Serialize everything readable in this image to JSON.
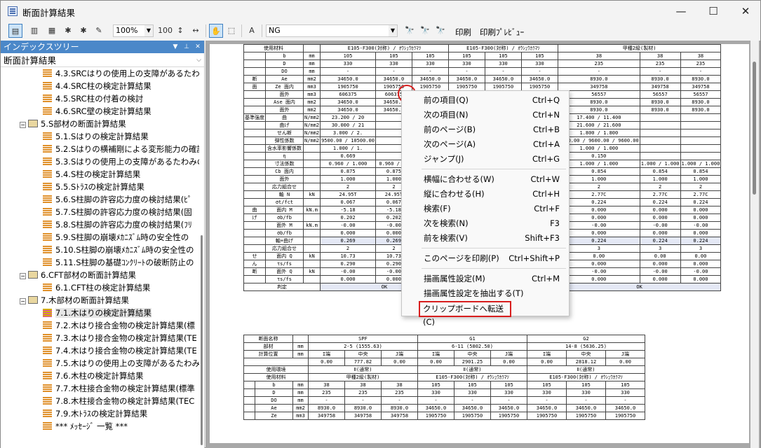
{
  "window": {
    "title": "断面計算結果",
    "minimize": "—",
    "maximize": "☐",
    "close": "✕"
  },
  "toolbar": {
    "zoom": "100%",
    "find_value": "NG",
    "print_label": "印刷",
    "preview_label": "印刷ﾌﾟﾚﾋﾞｭｰ"
  },
  "left_pane": {
    "title": "インデックスツリー",
    "selector": "断面計算結果",
    "items": [
      {
        "label": "4.3.SRCはりの使用上の支障があるたわみ",
        "kind": "leaf"
      },
      {
        "label": "4.4.SRC柱の検定計算結果",
        "kind": "leaf"
      },
      {
        "label": "4.5.SRC柱の付着の検討",
        "kind": "leaf"
      },
      {
        "label": "4.6.SRC壁の検定計算結果",
        "kind": "leaf"
      },
      {
        "label": "5.S部材の断面計算結果",
        "kind": "folder"
      },
      {
        "label": "5.1.Sはりの検定計算結果",
        "kind": "leaf"
      },
      {
        "label": "5.2.Sはりの横補剛による変形能力の確認",
        "kind": "leaf"
      },
      {
        "label": "5.3.Sはりの使用上の支障があるたわみの",
        "kind": "leaf"
      },
      {
        "label": "5.4.S柱の検定計算結果",
        "kind": "leaf"
      },
      {
        "label": "5.5.Sﾄﾗｽの検定計算結果",
        "kind": "leaf"
      },
      {
        "label": "5.6.S柱脚の許容応力度の検討結果(ﾋﾟ",
        "kind": "leaf"
      },
      {
        "label": "5.7.S柱脚の許容応力度の検討結果(固",
        "kind": "leaf"
      },
      {
        "label": "5.8.S柱脚の許容応力度の検討結果(ﾌﾘ",
        "kind": "leaf"
      },
      {
        "label": "5.9.S柱脚の崩壊ﾒｶﾆｽﾞﾑ時の安全性の",
        "kind": "leaf"
      },
      {
        "label": "5.10.S柱脚の崩壊ﾒｶﾆｽﾞﾑ時の安全性の",
        "kind": "leaf"
      },
      {
        "label": "5.11.S柱脚の基礎ｺﾝｸﾘｰﾄの破断防止の",
        "kind": "leaf"
      },
      {
        "label": "6.CFT部材の断面計算結果",
        "kind": "folder"
      },
      {
        "label": "6.1.CFT柱の検定計算結果",
        "kind": "leaf"
      },
      {
        "label": "7.木部材の断面計算結果",
        "kind": "folder"
      },
      {
        "label": "7.1.木はりの検定計算結果",
        "kind": "selected"
      },
      {
        "label": "7.2.木はり接合金物の検定計算結果(標",
        "kind": "leaf"
      },
      {
        "label": "7.3.木はり接合金物の検定計算結果(TE",
        "kind": "leaf"
      },
      {
        "label": "7.4.木はり接合金物の検定計算結果(TE",
        "kind": "leaf"
      },
      {
        "label": "7.5.木はりの使用上の支障があるたわみの",
        "kind": "leaf"
      },
      {
        "label": "7.6.木柱の検定計算結果",
        "kind": "leaf"
      },
      {
        "label": "7.7.木柱接合金物の検定計算結果(標準",
        "kind": "leaf"
      },
      {
        "label": "7.8.木柱接合金物の検定計算結果(TEC",
        "kind": "leaf"
      },
      {
        "label": "7.9.木ﾄﾗｽの検定計算結果",
        "kind": "leaf"
      },
      {
        "label": "*** ﾒｯｾｰｼﾞ 一覧 ***",
        "kind": "leaf"
      }
    ]
  },
  "table1": {
    "header": [
      "使用材料",
      "",
      "E105-F300(対称) / ｵｳｼｭｳｶﾗﾏﾂ",
      "E105-F300(対称) / ｵｳｼｭｳｶﾗﾏﾂ",
      "甲種2級(製材)"
    ],
    "rows": [
      [
        "",
        "b",
        "mm",
        "105",
        "105",
        "105",
        "105",
        "105",
        "105",
        "38",
        "38",
        "38"
      ],
      [
        "",
        "D",
        "mm",
        "330",
        "330",
        "330",
        "330",
        "330",
        "330",
        "235",
        "235",
        "235"
      ],
      [
        "",
        "DO",
        "mm",
        "-",
        "-",
        "-",
        "-",
        "-",
        "-",
        "-",
        "-",
        "-"
      ],
      [
        "断",
        "Ae",
        "mm2",
        "34650.0",
        "34650.0",
        "34650.0",
        "34650.0",
        "34650.0",
        "34650.0",
        "8930.0",
        "8930.0",
        "8930.0"
      ],
      [
        "面",
        "Ze 面内",
        "mm3",
        "1905750",
        "1905750",
        "1905750",
        "1905750",
        "1905750",
        "1905750",
        "349758",
        "349758",
        "349758"
      ],
      [
        "",
        "面外",
        "mm3",
        "606375",
        "606375",
        "606375",
        "606375",
        "606375",
        "606375",
        "56557",
        "56557",
        "56557"
      ],
      [
        "",
        "Ase 面内",
        "mm2",
        "34650.0",
        "34650.0",
        "34650.0",
        "34650.0",
        "34650.0",
        "34650.0",
        "8930.0",
        "8930.0",
        "8930.0"
      ],
      [
        "",
        "面外",
        "mm2",
        "34650.0",
        "34650.0",
        "34650.0",
        "34650.0",
        "34650.0",
        "34650.0",
        "8930.0",
        "8930.0",
        "8930.0"
      ],
      [
        "基準強度",
        "曲",
        "N/mm2",
        "23.200 / 20",
        "",
        "",
        "",
        "",
        "",
        "17.400 / 11.400",
        "",
        ""
      ],
      [
        "",
        "曲げ",
        "N/mm2",
        "30.000 / 21",
        "",
        "",
        "",
        "",
        "",
        "21.600 / 21.600",
        "",
        ""
      ],
      [
        "",
        "せん断",
        "N/mm2",
        "3.000 / 2.",
        "",
        "",
        "",
        "",
        "",
        "1.800 / 1.800",
        "",
        ""
      ],
      [
        "",
        "弾性係数",
        "N/mm2",
        "9500.00 / 10500.00",
        "",
        "",
        "",
        "",
        "",
        "9600.00 / 9600.00 / 9600.00",
        "",
        ""
      ],
      [
        "",
        "含水率影響係数",
        "",
        "1.000 / 1.",
        "",
        "",
        "",
        "",
        "",
        "1.000 / 1.000",
        "",
        ""
      ],
      [
        "",
        "η",
        "",
        "0.669",
        "",
        "",
        "",
        "",
        "",
        "0.150",
        "",
        ""
      ],
      [
        "",
        "寸法係数",
        "",
        "0.960 / 1.000",
        "0.960 / 1.",
        "",
        "",
        "",
        "1.000",
        "1.000 / 1.000",
        "1.000 / 1.000",
        "1.000 / 1.000"
      ],
      [
        "",
        "Cb 面内",
        "",
        "0.875",
        "0.875",
        "",
        "",
        "",
        "2",
        "0.854",
        "0.854",
        "0.854"
      ],
      [
        "",
        "面外",
        "",
        "1.000",
        "1.000",
        "",
        "",
        "",
        "0",
        "1.000",
        "1.000",
        "1.000"
      ],
      [
        "",
        "応力組合せ",
        "",
        "2",
        "2",
        "",
        "",
        "",
        "2",
        "2",
        "2",
        "2"
      ],
      [
        "",
        "軸 N",
        "kN",
        "24.95T",
        "24.95T",
        "",
        "",
        "",
        "5C",
        "2.77C",
        "2.77C",
        "2.77C"
      ],
      [
        "",
        "σt/fct",
        "",
        "0.067",
        "0.067",
        "",
        "",
        "",
        "4",
        "0.224",
        "0.224",
        "0.224"
      ],
      [
        "曲",
        "面内 M",
        "kN.m",
        "-5.18",
        "-5.18",
        "",
        "",
        "",
        "0",
        "0.000",
        "0.000",
        "0.000"
      ],
      [
        "げ",
        "σb/fb",
        "",
        "0.202",
        "0.202",
        "",
        "",
        "",
        "0",
        "0.000",
        "0.000",
        "0.000"
      ],
      [
        "",
        "面外 M",
        "kN.m",
        "-0.00",
        "-0.00",
        "",
        "",
        "",
        "0",
        "-0.00",
        "-0.00",
        "-0.00"
      ],
      [
        "",
        "σb/fb",
        "",
        "0.000",
        "0.000",
        "",
        "",
        "",
        "0",
        "0.000",
        "0.000",
        "0.000"
      ],
      [
        "",
        "軸+曲げ",
        "",
        "0.269",
        "0.269",
        "",
        "",
        "",
        "5",
        "0.224",
        "0.224",
        "0.224"
      ],
      [
        "",
        "応力組合せ",
        "",
        "2",
        "2",
        "",
        "",
        "",
        "3",
        "3",
        "3",
        "3"
      ],
      [
        "せ",
        "面内 Q",
        "kN",
        "10.73",
        "10.73",
        "",
        "",
        "",
        "0",
        "0.00",
        "0.00",
        "0.00"
      ],
      [
        "ん",
        "τs/fs",
        "",
        "0.290",
        "0.290",
        "",
        "",
        "",
        "0",
        "0.000",
        "0.000",
        "0.000"
      ],
      [
        "断",
        "面外 Q",
        "kN",
        "-0.00",
        "-0.00",
        "",
        "",
        "",
        "0",
        "-0.00",
        "-0.00",
        "-0.00"
      ],
      [
        "",
        "τs/fs",
        "",
        "0.000",
        "0.000",
        "",
        "",
        "",
        "0",
        "0.000",
        "0.000",
        "0.000"
      ]
    ],
    "judge": [
      "判定",
      "OK",
      "OK",
      "OK"
    ]
  },
  "table2": {
    "names": [
      "断面名称",
      "SPF",
      "G1",
      "G2"
    ],
    "members": [
      "部材",
      "mm",
      "2-5 (1555.63)",
      "6-11 (5802.50)",
      "14-8 (5636.25)"
    ],
    "calc_pos": [
      "計算位置",
      "mm",
      "I端",
      "中央",
      "J端",
      "I端",
      "中央",
      "J端",
      "I端",
      "中央",
      "J端"
    ],
    "calc_vals": [
      "0.00",
      "777.82",
      "0.00",
      "0.00",
      "2901.25",
      "0.00",
      "0.00",
      "2818.12",
      "0.00"
    ],
    "env": [
      "使用環境",
      "Ⅱ(通常)",
      "Ⅱ(通常)",
      "Ⅱ(通常)"
    ],
    "material": [
      "使用材料",
      "甲種2級(製材)",
      "E105-F300(対称) / ｵｳｼｭｳｶﾗﾏﾂ",
      "E105-F300(対称) / ｵｳｼｭｳｶﾗﾏﾂ"
    ],
    "rows": [
      [
        "b",
        "mm",
        "38",
        "38",
        "38",
        "105",
        "105",
        "105",
        "105",
        "105",
        "105"
      ],
      [
        "D",
        "mm",
        "235",
        "235",
        "235",
        "330",
        "330",
        "330",
        "330",
        "330",
        "330"
      ],
      [
        "DO",
        "mm",
        "-",
        "-",
        "-",
        "-",
        "-",
        "-",
        "-",
        "-",
        "-"
      ],
      [
        "Ae",
        "mm2",
        "8930.0",
        "8930.0",
        "8930.0",
        "34650.0",
        "34650.0",
        "34650.0",
        "34650.0",
        "34650.0",
        "34650.0"
      ],
      [
        "Ze",
        "mm3",
        "349758",
        "349758",
        "349758",
        "1905750",
        "1905750",
        "1905750",
        "1905750",
        "1905750",
        "1905750"
      ]
    ]
  },
  "context_menu": {
    "items": [
      {
        "label": "前の項目(Q)",
        "shortcut": "Ctrl+Q"
      },
      {
        "label": "次の項目(N)",
        "shortcut": "Ctrl+N"
      },
      {
        "label": "前のページ(B)",
        "shortcut": "Ctrl+B"
      },
      {
        "label": "次のページ(A)",
        "shortcut": "Ctrl+A"
      },
      {
        "label": "ジャンプ(J)",
        "shortcut": "Ctrl+G"
      },
      {
        "label": "横幅に合わせる(W)",
        "shortcut": "Ctrl+W"
      },
      {
        "label": "縦に合わせる(H)",
        "shortcut": "Ctrl+H"
      },
      {
        "label": "検索(F)",
        "shortcut": "Ctrl+F"
      },
      {
        "label": "次を検索(N)",
        "shortcut": "F3"
      },
      {
        "label": "前を検索(V)",
        "shortcut": "Shift+F3"
      },
      {
        "label": "このページを印刷(P)",
        "shortcut": "Ctrl+Shift+P"
      },
      {
        "label": "描画属性設定(M)",
        "shortcut": "Ctrl+M"
      },
      {
        "label": "描画属性設定を抽出する(T)",
        "shortcut": ""
      },
      {
        "label": "クリップボードへ転送(C)",
        "shortcut": ""
      }
    ]
  },
  "colors": {
    "pane_header": "#4b88c9",
    "highlight_box": "#d81e1e",
    "doc_bg": "#a8a8a8"
  }
}
